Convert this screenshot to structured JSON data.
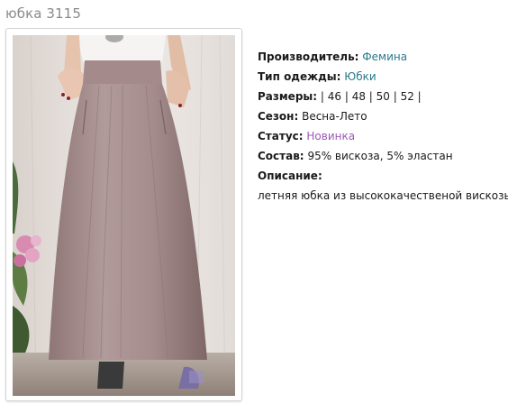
{
  "product": {
    "title": "юбка 3115",
    "image_alt": "юбка 3115"
  },
  "details": {
    "manufacturer_label": "Производитель:",
    "manufacturer_value": "Фемина",
    "type_label": "Тип одежды:",
    "type_value": "Юбки",
    "sizes_label": "Размеры:",
    "sizes_value": "| 46 | 48 | 50 | 52 |",
    "season_label": "Сезон:",
    "season_value": "Весна-Лето",
    "status_label": "Статус:",
    "status_value": "Новинка",
    "composition_label": "Состав:",
    "composition_value": "95% вискоза, 5% эластан",
    "description_label": "Описание:",
    "description_value": "летняя юбка из высококачественой вискозы."
  },
  "colors": {
    "link": "#2a7a8c",
    "status": "#9b59b6",
    "title": "#8a8a8a",
    "skirt": "#a88e8e"
  }
}
